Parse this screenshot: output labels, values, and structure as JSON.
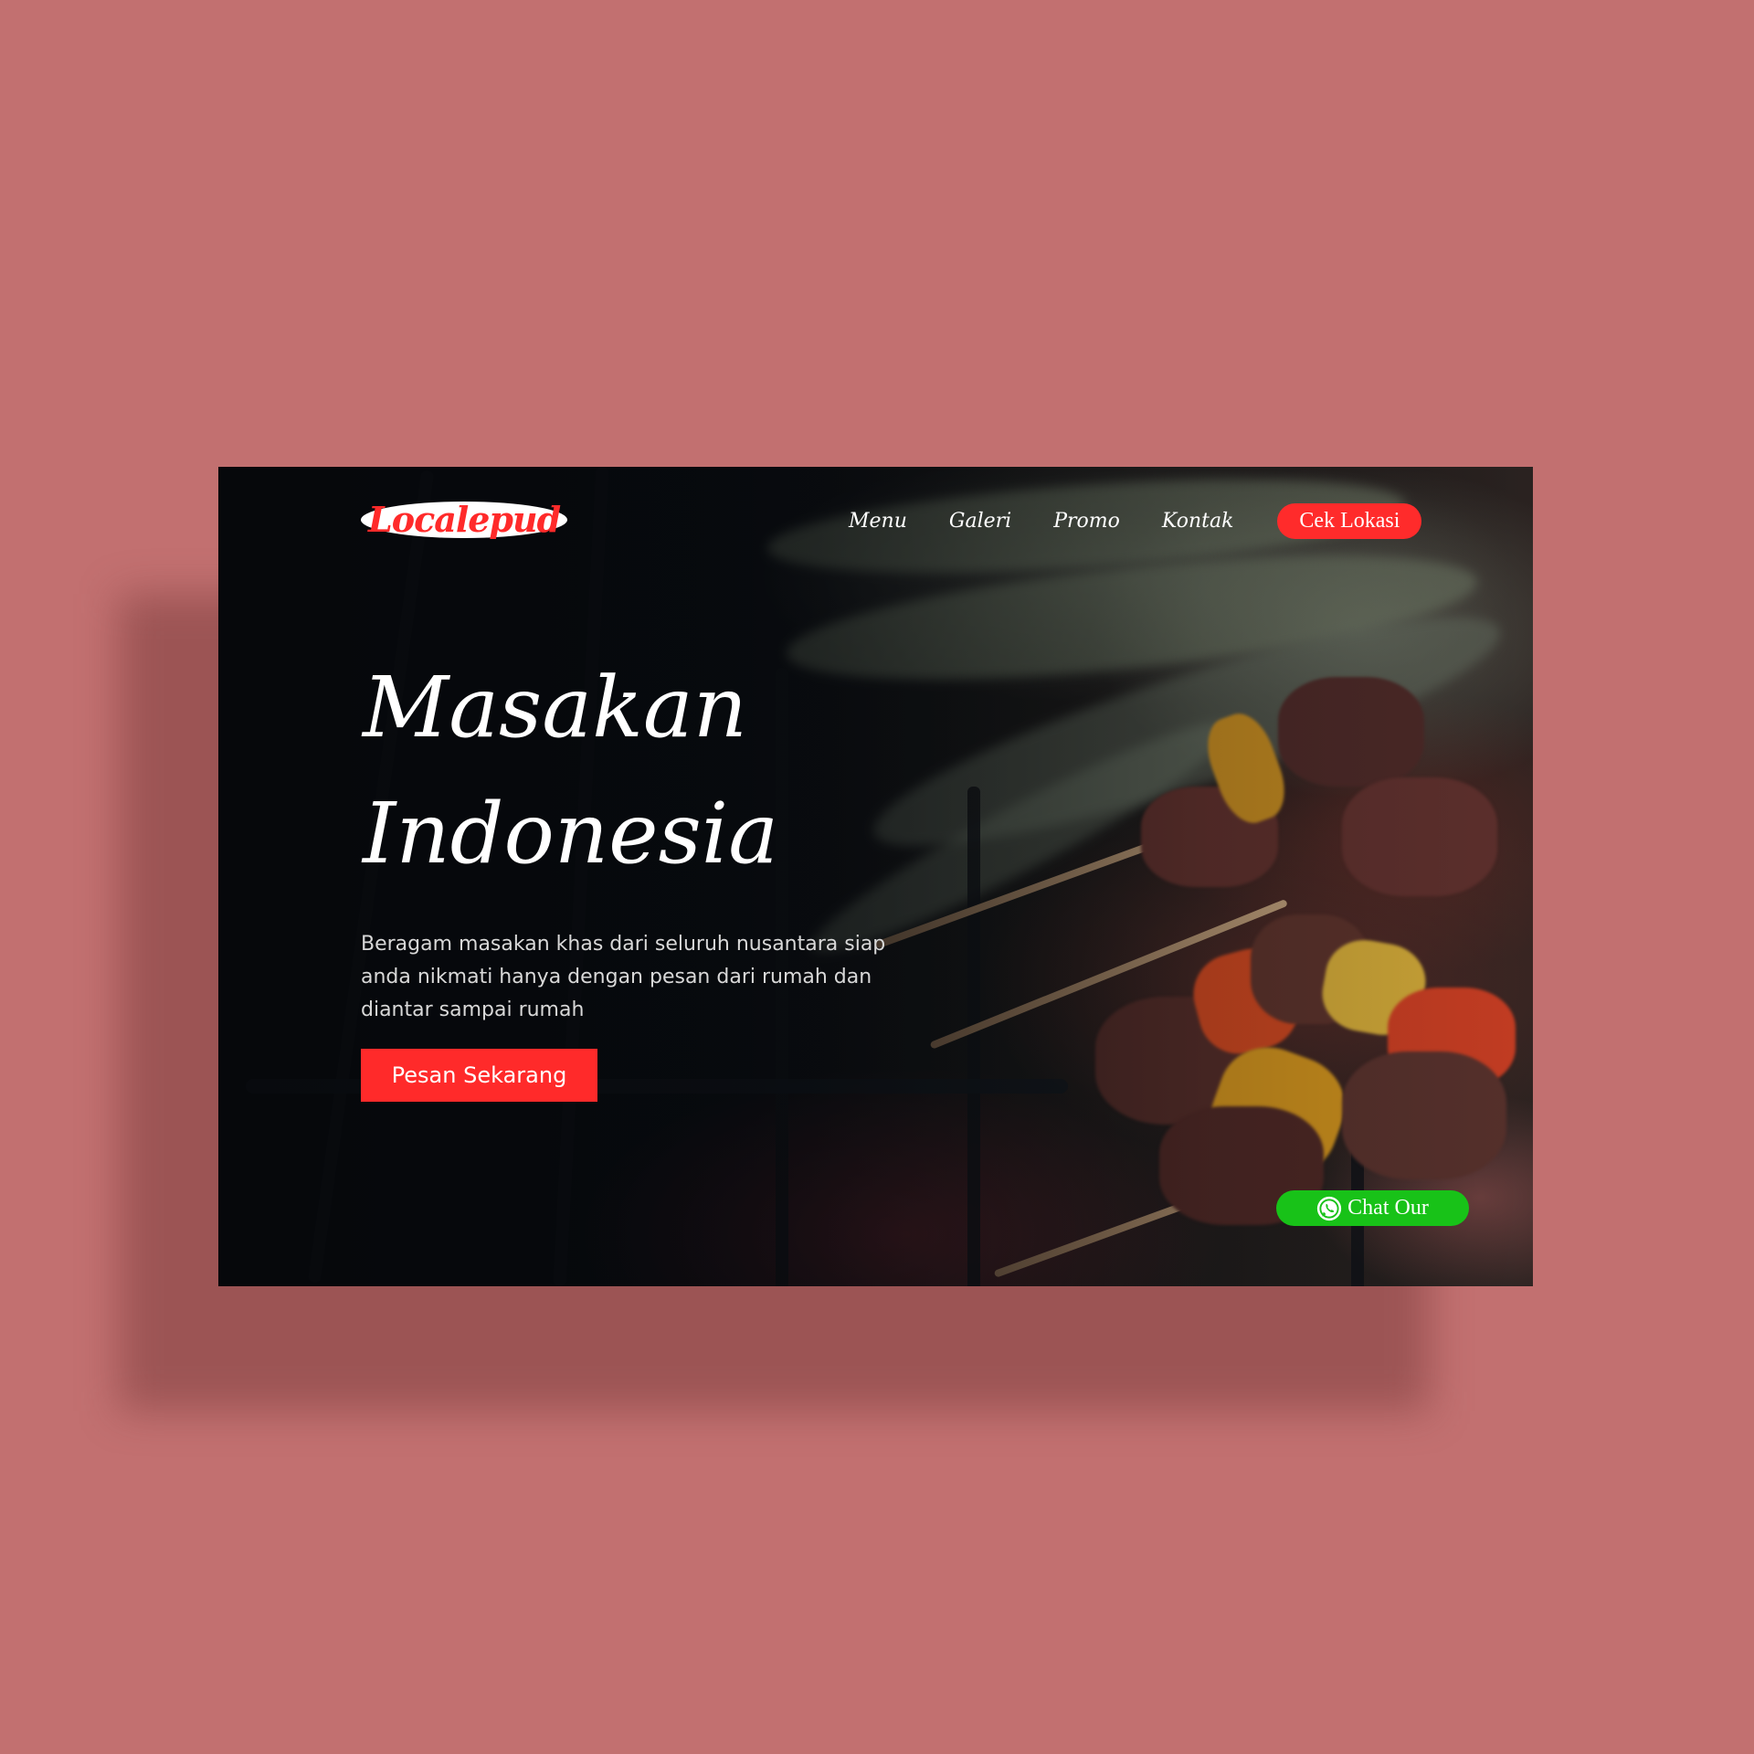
{
  "brand": {
    "logo_text": "Localepud"
  },
  "nav": {
    "items": [
      {
        "label": "Menu"
      },
      {
        "label": "Galeri"
      },
      {
        "label": "Promo"
      },
      {
        "label": "Kontak"
      }
    ],
    "cta_label": "Cek Lokasi"
  },
  "hero": {
    "title_line1": "Masakan",
    "title_line2": "Indonesia",
    "description": "Beragam masakan khas dari seluruh nusantara siap anda nikmati hanya dengan pesan dari rumah dan diantar sampai rumah",
    "button_label": "Pesan Sekarang"
  },
  "chat": {
    "label": "Chat Our",
    "icon": "whatsapp-icon"
  },
  "colors": {
    "page_background": "#c27070",
    "accent_red": "#ff2a2a",
    "chat_green": "#18c218",
    "text_light": "#d8d8d8"
  }
}
